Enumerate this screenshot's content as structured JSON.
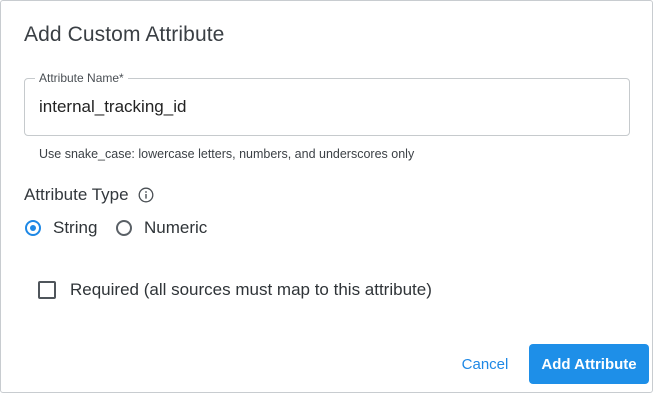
{
  "dialog": {
    "title": "Add Custom Attribute"
  },
  "name_field": {
    "label": "Attribute Name",
    "required_marker": "*",
    "value": "internal_tracking_id",
    "hint": "Use snake_case: lowercase letters, numbers, and underscores only"
  },
  "attribute_type": {
    "label": "Attribute Type",
    "info_icon": "info-icon",
    "options": [
      {
        "label": "String",
        "selected": true
      },
      {
        "label": "Numeric",
        "selected": false
      }
    ]
  },
  "required_option": {
    "label": "Required (all sources must map to this attribute)",
    "checked": false
  },
  "actions": {
    "cancel_label": "Cancel",
    "submit_label": "Add Attribute"
  },
  "colors": {
    "accent": "#1e88e5",
    "primary_button": "#1e8fe8",
    "border": "#c6cacd"
  }
}
